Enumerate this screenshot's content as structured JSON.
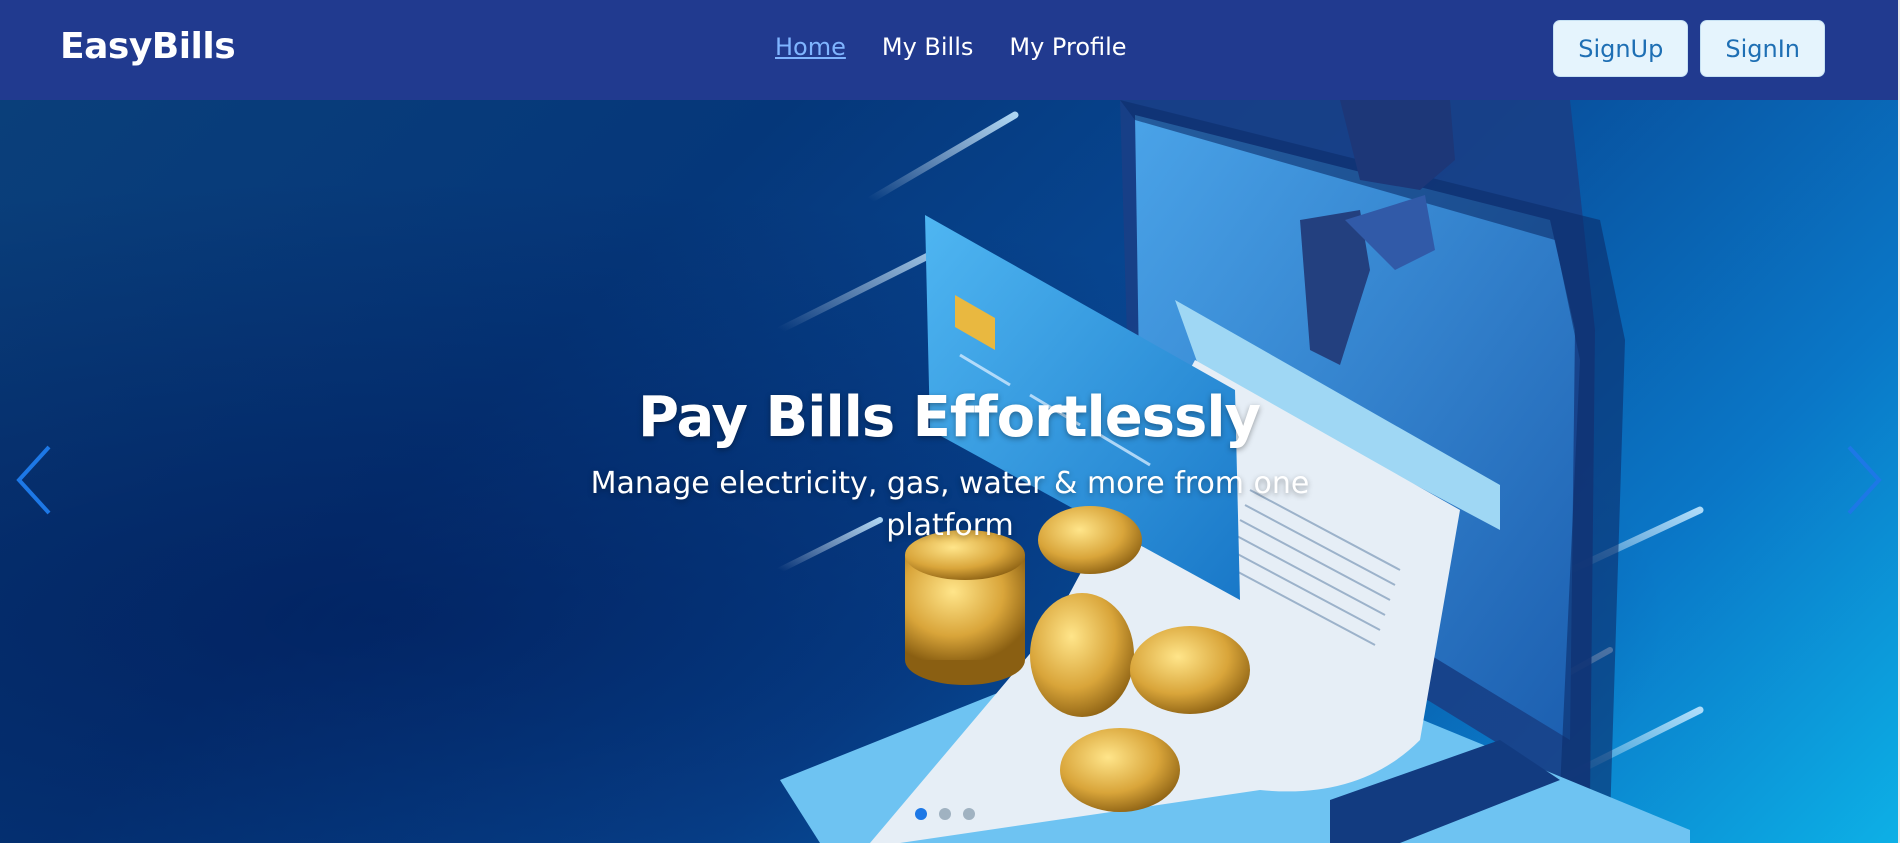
{
  "nav": {
    "brand": "EasyBills",
    "links": [
      {
        "label": "Home",
        "active": true
      },
      {
        "label": "My Bills",
        "active": false
      },
      {
        "label": "My Profile",
        "active": false
      }
    ],
    "signup_label": "SignUp",
    "signin_label": "SignIn"
  },
  "hero": {
    "title": "Pay Bills Effortlessly",
    "subtitle": "Manage electricity, gas, water & more from one platform",
    "slide_count": 3,
    "active_slide": 1
  },
  "colors": {
    "navbar": "#213a8f",
    "nav_active": "#7fb4ff",
    "button_bg": "#e5f4fd",
    "button_text": "#1e6fb4",
    "indicator_active": "#1d78e6"
  },
  "icons": {
    "prev": "chevron-left-icon",
    "next": "chevron-right-icon"
  }
}
